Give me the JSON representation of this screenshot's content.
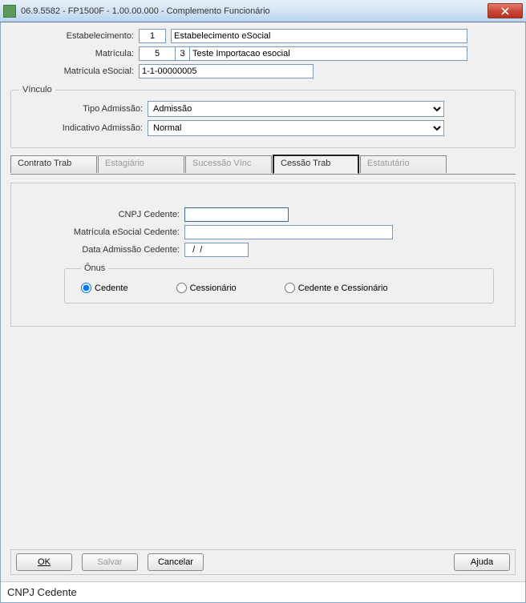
{
  "window": {
    "title": "06.9.5582 - FP1500F - 1.00.00.000 - Complemento Funcionário"
  },
  "header": {
    "estabelecimento_label": "Estabelecimento:",
    "estabelecimento_code": "1",
    "estabelecimento_name": "Estabelecimento eSocial",
    "matricula_label": "Matrícula:",
    "matricula_code": "5",
    "matricula_sub": "3",
    "matricula_name": "Teste Importacao esocial",
    "matricula_esocial_label": "Matrícula eSocial:",
    "matricula_esocial_value": "1-1-00000005"
  },
  "vinculo": {
    "legend": "Vínculo",
    "tipo_admissao_label": "Tipo Admissão:",
    "tipo_admissao_value": "Admissão",
    "indicativo_admissao_label": "Indicativo Admissão:",
    "indicativo_admissao_value": "Normal"
  },
  "tabs": {
    "contrato": "Contrato Trab",
    "estagiario": "Estagiário",
    "sucessao": "Sucessão Vínc",
    "cessao": "Cessão Trab",
    "estatutario": "Estatutário"
  },
  "cessao": {
    "cnpj_label": "CNPJ Cedente:",
    "cnpj_value": "",
    "matricula_label": "Matrícula eSocial Cedente:",
    "matricula_value": "",
    "data_label": "Data Admissão Cedente:",
    "data_value": "  /  /",
    "onus_legend": "Ônus",
    "radio_cedente": "Cedente",
    "radio_cessionario": "Cessionário",
    "radio_ambos": "Cedente e Cessionário"
  },
  "buttons": {
    "ok": "OK",
    "salvar": "Salvar",
    "cancelar": "Cancelar",
    "ajuda": "Ajuda"
  },
  "status": "CNPJ Cedente"
}
